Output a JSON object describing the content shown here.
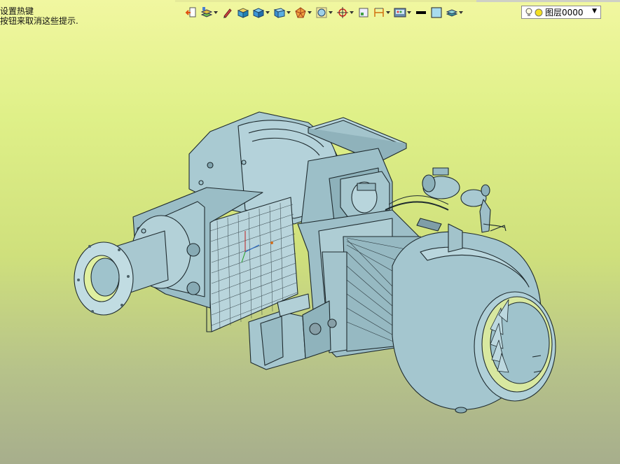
{
  "hint": {
    "line1": "设置热键",
    "line2": "按钮来取消这些提示."
  },
  "toolbar": {
    "tools": [
      {
        "icon": "exit-icon"
      },
      {
        "icon": "layer-properties-icon",
        "dropdown": true
      },
      {
        "icon": "pen-icon"
      },
      {
        "icon": "solid-box-icon"
      },
      {
        "icon": "blue-cube-icon",
        "dropdown": true
      },
      {
        "icon": "view-cube-icon",
        "dropdown": true
      },
      {
        "icon": "polygon-icon",
        "dropdown": true
      },
      {
        "icon": "snap-grid-icon",
        "dropdown": true
      },
      {
        "icon": "crosshair-icon",
        "dropdown": true
      },
      {
        "icon": "frame-icon"
      },
      {
        "icon": "dimension-icon",
        "dropdown": true
      },
      {
        "icon": "screen-display-icon",
        "dropdown": true
      },
      {
        "icon": "line-weight-icon"
      },
      {
        "icon": "color-swatch-icon"
      },
      {
        "icon": "layer-stack-icon",
        "dropdown": true
      }
    ],
    "layer": {
      "name": "图层0000",
      "lightbulb_icon": "lightbulb-icon",
      "status_icon": "layer-on-icon"
    }
  },
  "colors": {
    "model_fill": "#9fc3cc",
    "model_stroke": "#1e2a2e",
    "bg_top": "#f1f7a0",
    "bg_bottom": "#a7ae8c"
  }
}
